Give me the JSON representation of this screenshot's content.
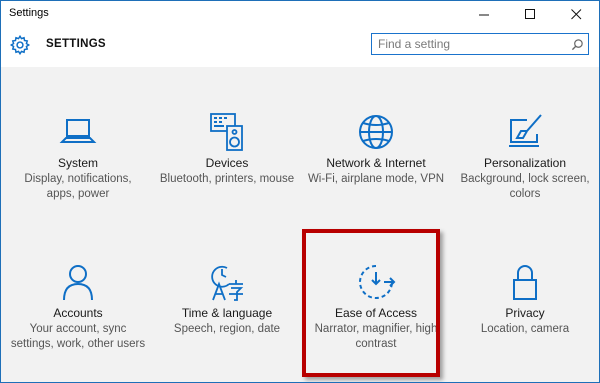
{
  "window": {
    "title": "Settings"
  },
  "header": {
    "title": "SETTINGS"
  },
  "search": {
    "placeholder": "Find a setting"
  },
  "colors": {
    "accent": "#0f6fc6",
    "highlight": "#b80000"
  },
  "tiles": [
    {
      "name": "System",
      "desc": "Display, notifications, apps, power",
      "icon": "laptop-icon"
    },
    {
      "name": "Devices",
      "desc": "Bluetooth, printers, mouse",
      "icon": "devices-icon"
    },
    {
      "name": "Network & Internet",
      "desc": "Wi-Fi, airplane mode, VPN",
      "icon": "globe-icon"
    },
    {
      "name": "Personalization",
      "desc": "Background, lock screen, colors",
      "icon": "paintbrush-icon"
    },
    {
      "name": "Accounts",
      "desc": "Your account, sync settings, work, other users",
      "icon": "person-icon"
    },
    {
      "name": "Time & language",
      "desc": "Speech, region, date",
      "icon": "time-language-icon"
    },
    {
      "name": "Ease of Access",
      "desc": "Narrator, magnifier, high contrast",
      "icon": "ease-of-access-icon"
    },
    {
      "name": "Privacy",
      "desc": "Location, camera",
      "icon": "lock-icon"
    }
  ]
}
